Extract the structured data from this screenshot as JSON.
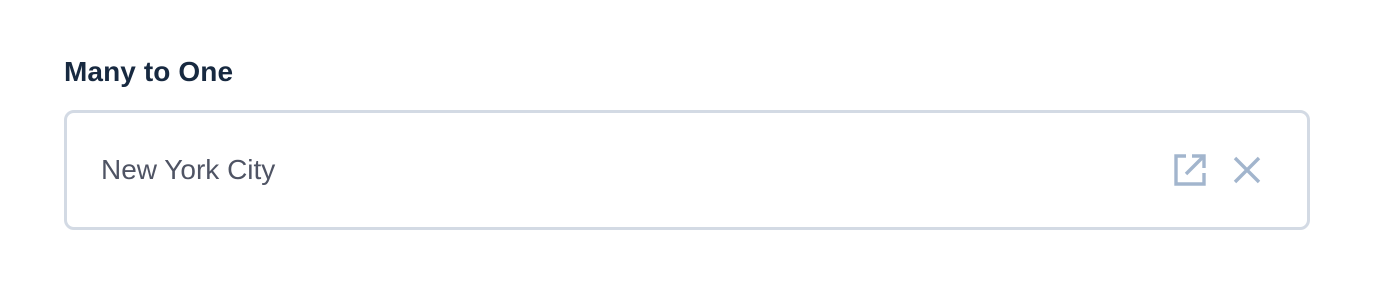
{
  "field": {
    "label": "Many to One",
    "value": "New York City",
    "actions": {
      "open": {
        "icon": "open-in-new-icon"
      },
      "clear": {
        "icon": "close-icon"
      }
    }
  },
  "colors": {
    "label": "#172940",
    "value_text": "#4f5464",
    "border": "#d3dae4",
    "icon": "#a2b5cd"
  }
}
